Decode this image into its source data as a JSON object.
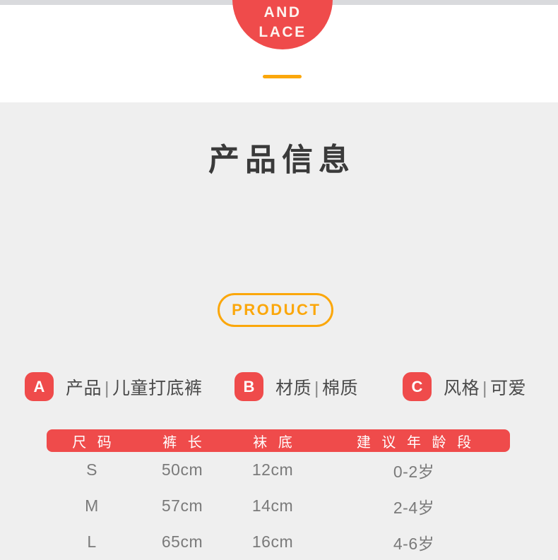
{
  "theme": {
    "red": "#ef4b4b",
    "orange": "#fba70b",
    "gray_bg": "#efefef",
    "top_strip": "#d9dadd",
    "text_dark": "#3a3a3a",
    "text_gray": "#7a7a7a"
  },
  "hero": {
    "banner_line1": "AND",
    "banner_line2": "LACE"
  },
  "section": {
    "title": "产品信息",
    "pill_label": "PRODUCT"
  },
  "attributes": [
    {
      "badge": "A",
      "label": "产品",
      "sep": "|",
      "value": "儿童打底裤"
    },
    {
      "badge": "B",
      "label": "材质",
      "sep": "|",
      "value": "棉质"
    },
    {
      "badge": "C",
      "label": "风格",
      "sep": "|",
      "value": "可爱"
    }
  ],
  "spec_table": {
    "headers": [
      "尺 码",
      "裤 长",
      "袜 底",
      "建 议 年 龄 段"
    ],
    "rows": [
      [
        "S",
        "50cm",
        "12cm",
        "0-2岁"
      ],
      [
        "M",
        "57cm",
        "14cm",
        "2-4岁"
      ],
      [
        "L",
        "65cm",
        "16cm",
        "4-6岁"
      ]
    ]
  }
}
